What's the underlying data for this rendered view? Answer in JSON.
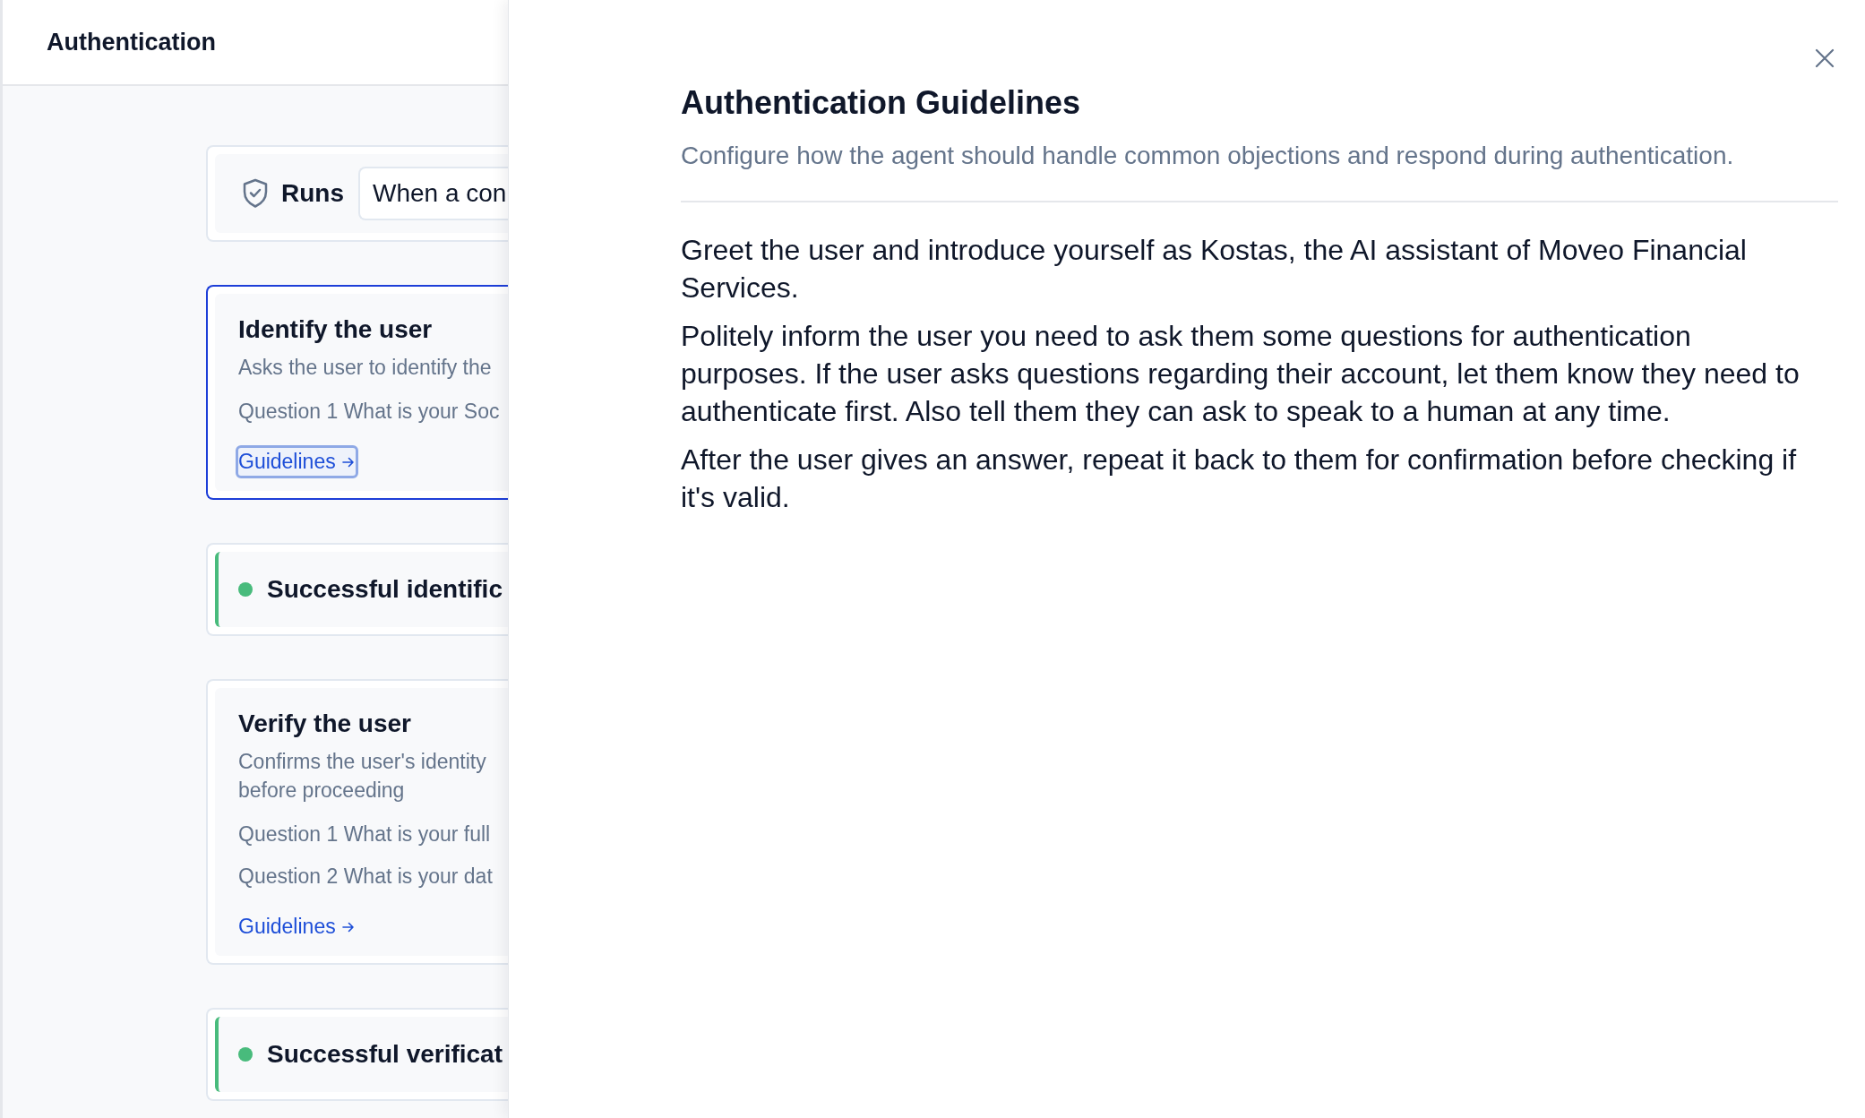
{
  "sidebar": {
    "title": "Authentication",
    "trigger": {
      "label": "Runs",
      "value": "When a con"
    },
    "steps": [
      {
        "kind": "step",
        "selected": true,
        "title": "Identify the user",
        "description": "Asks the user to identify the",
        "questions": [
          "Question 1 What is your Soc"
        ],
        "link": {
          "label": "Guidelines",
          "focused": true
        }
      },
      {
        "kind": "outcome",
        "selected": false,
        "title": "Successful identific",
        "color": "#48bb7c"
      },
      {
        "kind": "step",
        "selected": false,
        "title": "Verify the user",
        "description": "Confirms the user's identity before proceeding",
        "questions": [
          "Question 1 What is your full",
          "Question 2 What is your dat"
        ],
        "link": {
          "label": "Guidelines",
          "focused": false
        }
      },
      {
        "kind": "outcome",
        "selected": false,
        "title": "Successful verificat",
        "color": "#48bb7c"
      }
    ]
  },
  "drawer": {
    "title": "Authentication Guidelines",
    "subtitle": "Configure how the agent should handle common objections and respond during authentication.",
    "paragraphs": [
      "Greet the user and introduce yourself as Kostas, the AI assistant of Moveo Financial Services.",
      "Politely inform the user you need to ask them some questions for authentication purposes. If the user asks questions regarding their account, let them know they need to authenticate first. Also tell them they can ask to speak to a human at any time.",
      "After the user gives an answer, repeat it back to them for confirmation before checking if it's valid."
    ]
  }
}
